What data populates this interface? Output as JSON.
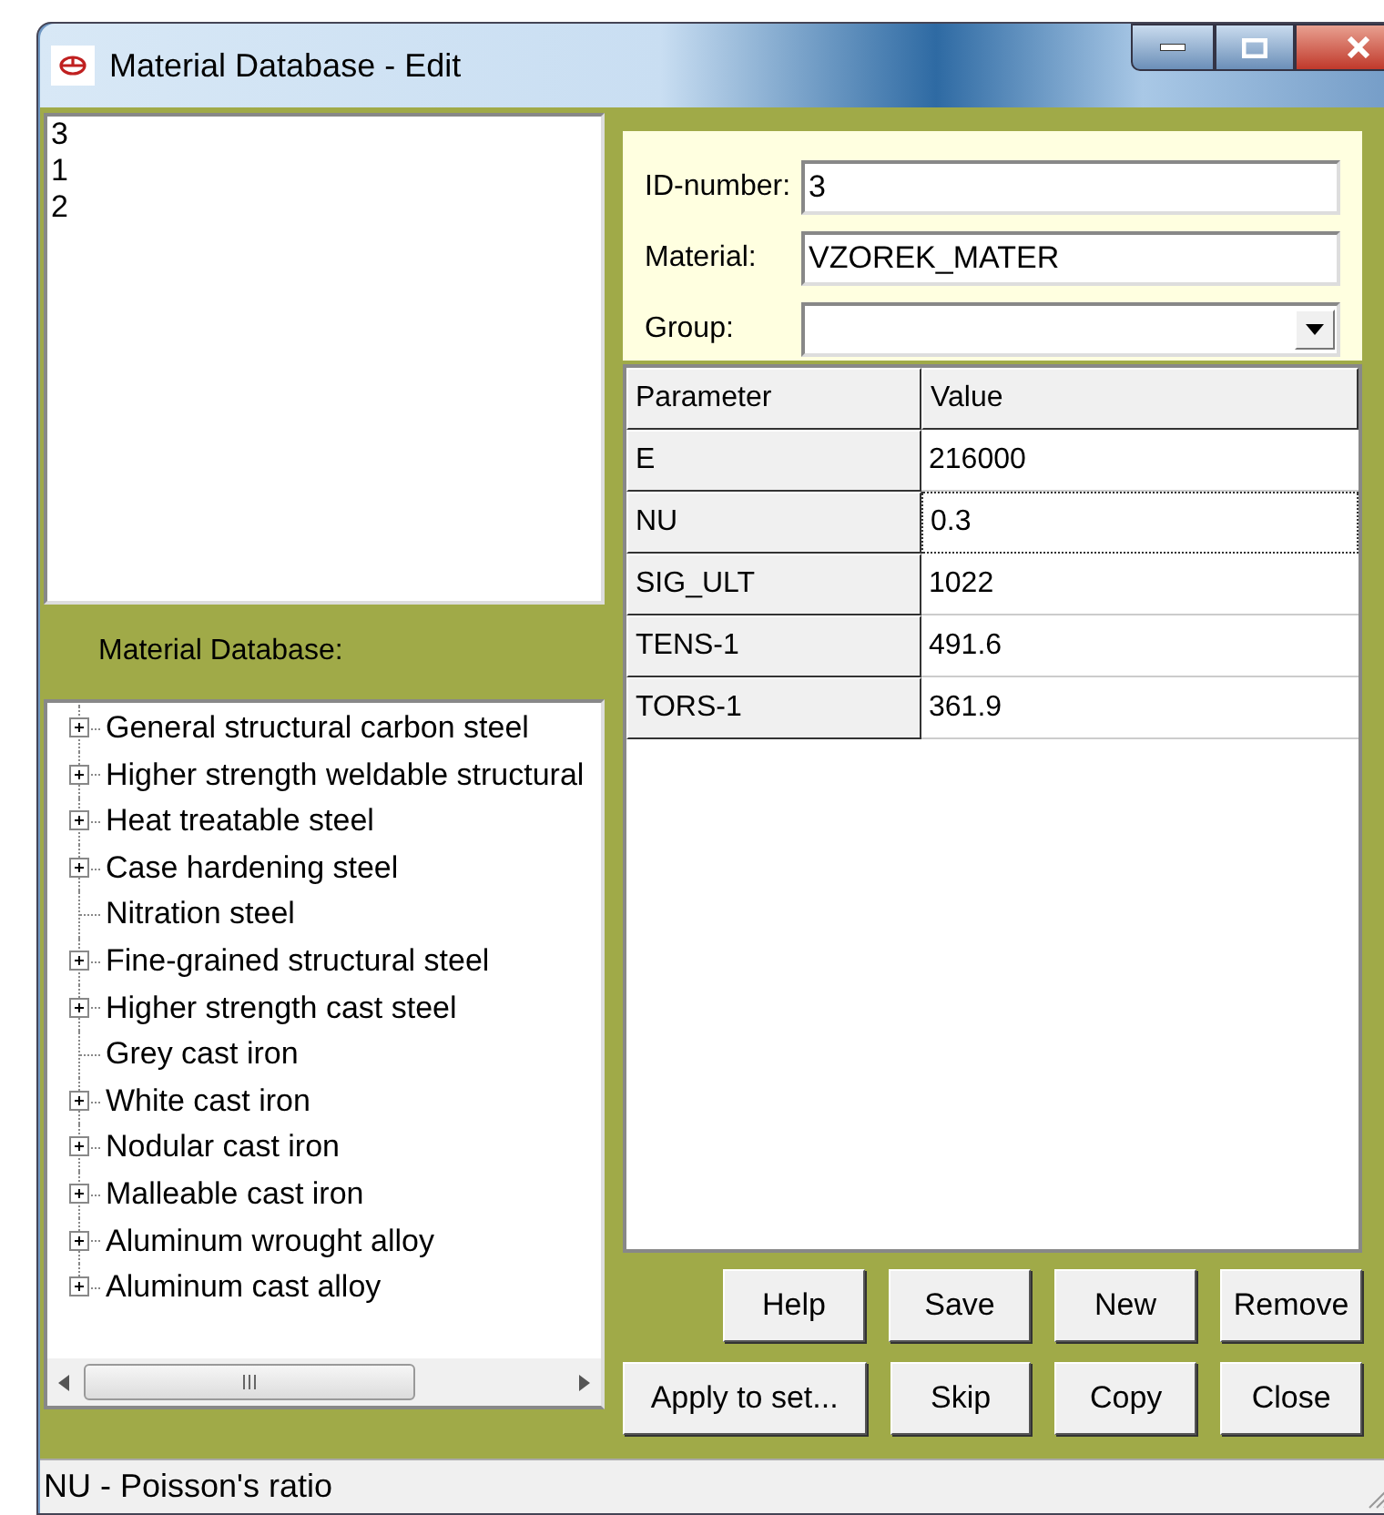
{
  "window": {
    "title": "Material Database - Edit"
  },
  "id_list": [
    "3",
    "1",
    "2"
  ],
  "form": {
    "id_label": "ID-number:",
    "id_value": "3",
    "material_label": "Material:",
    "material_value": "VZOREK_MATER",
    "group_label": "Group:"
  },
  "tree": {
    "heading": "Material Database:",
    "items": [
      {
        "label": "General structural carbon steel",
        "kind": "expandable"
      },
      {
        "label": "Higher strength weldable structural",
        "kind": "expandable"
      },
      {
        "label": "Heat treatable steel",
        "kind": "expandable"
      },
      {
        "label": "Case hardening steel",
        "kind": "expandable"
      },
      {
        "label": "Nitration steel",
        "kind": "leaf"
      },
      {
        "label": "Fine-grained structural steel",
        "kind": "expandable"
      },
      {
        "label": "Higher strength cast steel",
        "kind": "expandable"
      },
      {
        "label": "Grey cast iron",
        "kind": "leaf"
      },
      {
        "label": "White cast iron",
        "kind": "expandable"
      },
      {
        "label": "Nodular cast iron",
        "kind": "expandable"
      },
      {
        "label": "Malleable cast iron",
        "kind": "expandable"
      },
      {
        "label": "Aluminum wrought alloy",
        "kind": "expandable"
      },
      {
        "label": "Aluminum cast alloy",
        "kind": "expandable"
      }
    ]
  },
  "table": {
    "columns": [
      "Parameter",
      "Value"
    ],
    "rows": [
      {
        "parameter": "E",
        "value": "216000",
        "selected": false
      },
      {
        "parameter": "NU",
        "value": "0.3",
        "selected": true
      },
      {
        "parameter": "SIG_ULT",
        "value": "1022",
        "selected": false
      },
      {
        "parameter": "TENS-1",
        "value": "491.6",
        "selected": false
      },
      {
        "parameter": "TORS-1",
        "value": "361.9",
        "selected": false
      }
    ]
  },
  "buttons": [
    [
      {
        "label": "Help"
      },
      {
        "label": "Save"
      },
      {
        "label": "New"
      },
      {
        "label": "Remove"
      }
    ],
    [
      {
        "label": "Apply to set..."
      },
      {
        "label": "Skip"
      },
      {
        "label": "Copy"
      },
      {
        "label": "Close"
      }
    ]
  ],
  "status_bar": "NU - Poisson's ratio"
}
